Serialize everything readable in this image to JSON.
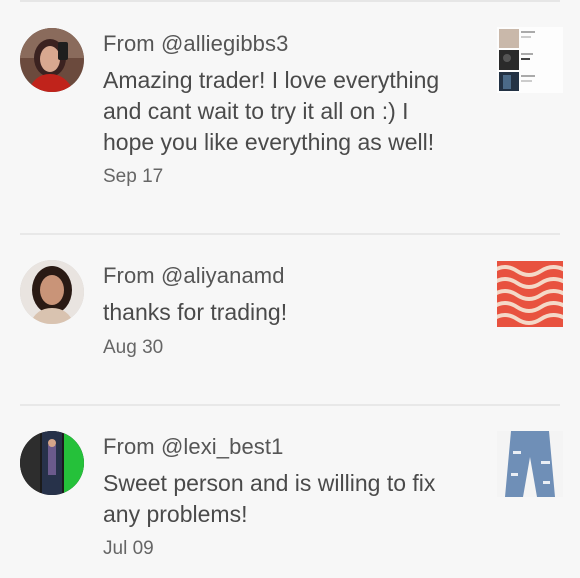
{
  "reviews": [
    {
      "from": "From @alliegibbs3",
      "message_lines": [
        "Amazing trader! I love everything",
        "and cant wait to try it all on :) I",
        "hope you like everything as well!"
      ],
      "date": "Sep 17",
      "avatar_icon": "user-photo-avatar",
      "thumb_icon": "multi-item-order-thumbnail"
    },
    {
      "from": "From @aliyanamd",
      "message_lines": [
        "thanks for trading!"
      ],
      "date": "Aug 30",
      "avatar_icon": "user-photo-avatar",
      "thumb_icon": "patterned-fabric-thumbnail"
    },
    {
      "from": "From @lexi_best1",
      "message_lines": [
        "Sweet person and is willing to fix",
        "any problems!"
      ],
      "date": "Jul 09",
      "avatar_icon": "user-photo-avatar",
      "thumb_icon": "ripped-jeans-thumbnail"
    }
  ],
  "colors": {
    "background": "#f7f7f7",
    "text": "#4a4a4a",
    "divider": "#e8e8e8"
  }
}
